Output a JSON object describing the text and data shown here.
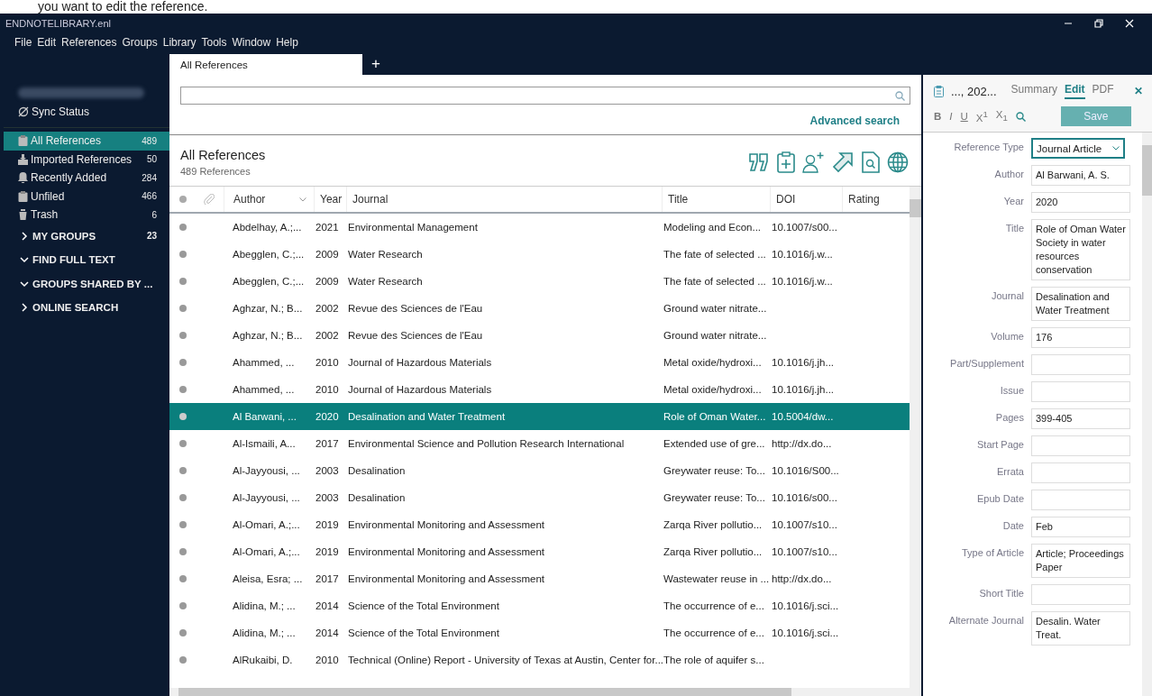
{
  "doc_caption": "you want to edit the reference.",
  "window": {
    "title": "ENDNOTELIBRARY.enl"
  },
  "menu": [
    "File",
    "Edit",
    "References",
    "Groups",
    "Library",
    "Tools",
    "Window",
    "Help"
  ],
  "tabs": [
    {
      "label": "All References",
      "selected": true
    }
  ],
  "new_tab": "+",
  "sidebar": {
    "sync_status": "Sync Status",
    "items": [
      {
        "label": "All References",
        "count": "489",
        "selected": true,
        "kind": "all"
      },
      {
        "label": "Imported References",
        "count": "50",
        "selected": false,
        "kind": "imported"
      },
      {
        "label": "Recently Added",
        "count": "284",
        "selected": false,
        "kind": "recent"
      },
      {
        "label": "Unfiled",
        "count": "466",
        "selected": false,
        "kind": "unfiled"
      },
      {
        "label": "Trash",
        "count": "6",
        "selected": false,
        "kind": "trash"
      }
    ],
    "groups": [
      {
        "label": "MY GROUPS",
        "count": "23",
        "expanded": false
      },
      {
        "label": "FIND FULL TEXT",
        "expanded": true
      },
      {
        "label": "GROUPS SHARED BY ...",
        "expanded": true
      },
      {
        "label": "ONLINE SEARCH",
        "expanded": false
      }
    ]
  },
  "advanced_search": "Advanced search",
  "library_header": {
    "title": "All References",
    "count": "489 References"
  },
  "table": {
    "columns": [
      "Author",
      "Year",
      "Journal",
      "Title",
      "DOI",
      "Rating"
    ],
    "rows": [
      {
        "author": "Abdelhay, A.;...",
        "year": "2021",
        "journal": "Environmental Management",
        "title": "Modeling and Econ...",
        "doi": "10.1007/s00...",
        "selected": false
      },
      {
        "author": "Abegglen, C.;...",
        "year": "2009",
        "journal": "Water Research",
        "title": "The fate of selected ...",
        "doi": "10.1016/j.w...",
        "selected": false
      },
      {
        "author": "Abegglen, C.;...",
        "year": "2009",
        "journal": "Water Research",
        "title": "The fate of selected ...",
        "doi": "10.1016/j.w...",
        "selected": false
      },
      {
        "author": "Aghzar, N.; B...",
        "year": "2002",
        "journal": "Revue des Sciences de l'Eau",
        "title": "Ground water nitrate...",
        "selected": false
      },
      {
        "author": "Aghzar, N.; B...",
        "year": "2002",
        "journal": "Revue des Sciences de l'Eau",
        "title": "Ground water nitrate...",
        "selected": false
      },
      {
        "author": "Ahammed, ...",
        "year": "2010",
        "journal": "Journal of Hazardous Materials",
        "title": "Metal oxide/hydroxi...",
        "doi": "10.1016/j.jh...",
        "selected": false
      },
      {
        "author": "Ahammed, ...",
        "year": "2010",
        "journal": "Journal of Hazardous Materials",
        "title": "Metal oxide/hydroxi...",
        "doi": "10.1016/j.jh...",
        "selected": false
      },
      {
        "author": "Al Barwani, ...",
        "year": "2020",
        "journal": "Desalination and Water Treatment",
        "title": "Role of Oman Water...",
        "doi": "10.5004/dw...",
        "selected": true
      },
      {
        "author": "Al-Ismaili, A...",
        "year": "2017",
        "journal": "Environmental Science and Pollution Research International",
        "title": "Extended use of gre...",
        "doi": "http://dx.do...",
        "selected": false
      },
      {
        "author": "Al-Jayyousi, ...",
        "year": "2003",
        "journal": "Desalination",
        "title": "Greywater reuse: To...",
        "doi": "10.1016/S00...",
        "selected": false
      },
      {
        "author": "Al-Jayyousi, ...",
        "year": "2003",
        "journal": "Desalination",
        "title": "Greywater reuse: To...",
        "doi": "10.1016/s00...",
        "selected": false
      },
      {
        "author": "Al-Omari, A.;...",
        "year": "2019",
        "journal": "Environmental Monitoring and Assessment",
        "title": "Zarqa River pollutio...",
        "doi": "10.1007/s10...",
        "selected": false
      },
      {
        "author": "Al-Omari, A.;...",
        "year": "2019",
        "journal": "Environmental Monitoring and Assessment",
        "title": "Zarqa River pollutio...",
        "doi": "10.1007/s10...",
        "selected": false
      },
      {
        "author": "Aleisa, Esra; ...",
        "year": "2017",
        "journal": "Environmental Monitoring and Assessment",
        "title": "Wastewater reuse in ...",
        "doi": "http://dx.do...",
        "selected": false
      },
      {
        "author": "Alidina, M.; ...",
        "year": "2014",
        "journal": "Science of the Total Environment",
        "title": "The occurrence of e...",
        "doi": "10.1016/j.sci...",
        "selected": false
      },
      {
        "author": "Alidina, M.; ...",
        "year": "2014",
        "journal": "Science of the Total Environment",
        "title": "The occurrence of e...",
        "doi": "10.1016/j.sci...",
        "selected": false
      },
      {
        "author": "AlRukaibi, D.",
        "year": "2010",
        "journal": "Technical (Online) Report - University of Texas at Austin, Center for...",
        "title": "The role of aquifer s...",
        "selected": false
      }
    ]
  },
  "editor": {
    "reference_label": "..., 202...",
    "tabs": [
      {
        "label": "Summary",
        "selected": false
      },
      {
        "label": "Edit",
        "selected": true
      },
      {
        "label": "PDF",
        "selected": false
      }
    ],
    "close": "✕",
    "format_buttons": [
      "B",
      "I",
      "U",
      "X$^{1}$",
      "X$_{1}$"
    ],
    "save": "Save",
    "fields": [
      {
        "label": "Reference Type",
        "value": "Journal Article",
        "kind": "select"
      },
      {
        "label": "Author",
        "value": "Al Barwani, A. S.",
        "kind": "text"
      },
      {
        "label": "Year",
        "value": "2020",
        "kind": "text"
      },
      {
        "label": "Title",
        "value": "Role of Oman Water Society in water resources conservation",
        "kind": "text"
      },
      {
        "label": "Journal",
        "value": "Desalination and Water Treatment",
        "kind": "text"
      },
      {
        "label": "Volume",
        "value": "176",
        "kind": "text"
      },
      {
        "label": "Part/Supplement",
        "kind": "text"
      },
      {
        "label": "Issue",
        "kind": "text"
      },
      {
        "label": "Pages",
        "value": "399-405",
        "kind": "text"
      },
      {
        "label": "Start Page",
        "kind": "text"
      },
      {
        "label": "Errata",
        "kind": "text"
      },
      {
        "label": "Epub Date",
        "kind": "text"
      },
      {
        "label": "Date",
        "value": "Feb",
        "kind": "text"
      },
      {
        "label": "Type of Article",
        "value": "Article; Proceedings Paper",
        "kind": "text"
      },
      {
        "label": "Short Title",
        "kind": "text"
      },
      {
        "label": "Alternate Journal",
        "value": "Desalin. Water Treat.",
        "kind": "text"
      }
    ]
  }
}
